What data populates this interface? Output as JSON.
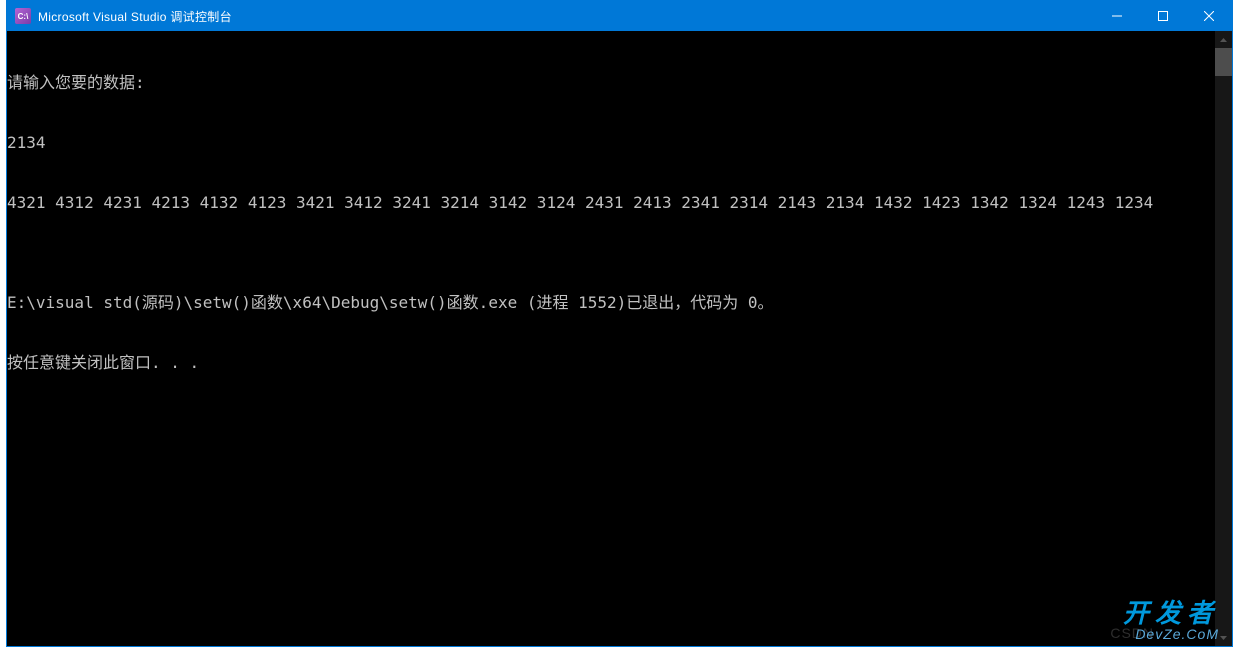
{
  "titlebar": {
    "icon_text": "C:\\",
    "title": "Microsoft Visual Studio 调试控制台"
  },
  "console": {
    "prompt_line": "请输入您要的数据:",
    "input_line": "2134",
    "output_line": "4321 4312 4231 4213 4132 4123 3421 3412 3241 3214 3142 3124 2431 2413 2341 2314 2143 2134 1432 1423 1342 1324 1243 1234",
    "blank_line": "",
    "exit_line": "E:\\visual std(源码)\\setw()函数\\x64\\Debug\\setw()函数.exe (进程 1552)已退出，代码为 0。",
    "close_line": "按任意键关闭此窗口. . ."
  },
  "watermark": {
    "csdn": "CSDN",
    "main": "开发者",
    "sub": "DevZe.CoM"
  }
}
